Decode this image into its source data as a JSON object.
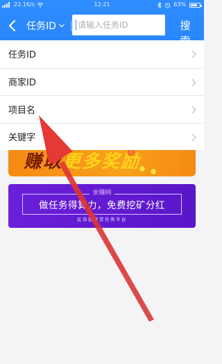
{
  "status_bar": {
    "left_text": "22.1K/s",
    "time": "12:21",
    "battery": "63%"
  },
  "search_bar": {
    "filter_label": "任务ID",
    "placeholder": "请输入任务ID",
    "search_label": "搜 索"
  },
  "menu": {
    "items": [
      {
        "label": "任务ID"
      },
      {
        "label": "商家ID"
      },
      {
        "label": "项目名"
      },
      {
        "label": "关键字"
      }
    ]
  },
  "banner_orange": {
    "text_a": "赚取",
    "text_b": "更多奖励"
  },
  "banner_purple": {
    "brand": "余赚网",
    "headline": "做任务得算力，免费挖矿分红",
    "subtitle": "区块链悬赏任务平台"
  },
  "colors": {
    "header_blue": "#2a86fb",
    "annotation_red": "#e53935",
    "banner_purple": "#5b16c9",
    "banner_orange": "#f7a11b"
  }
}
